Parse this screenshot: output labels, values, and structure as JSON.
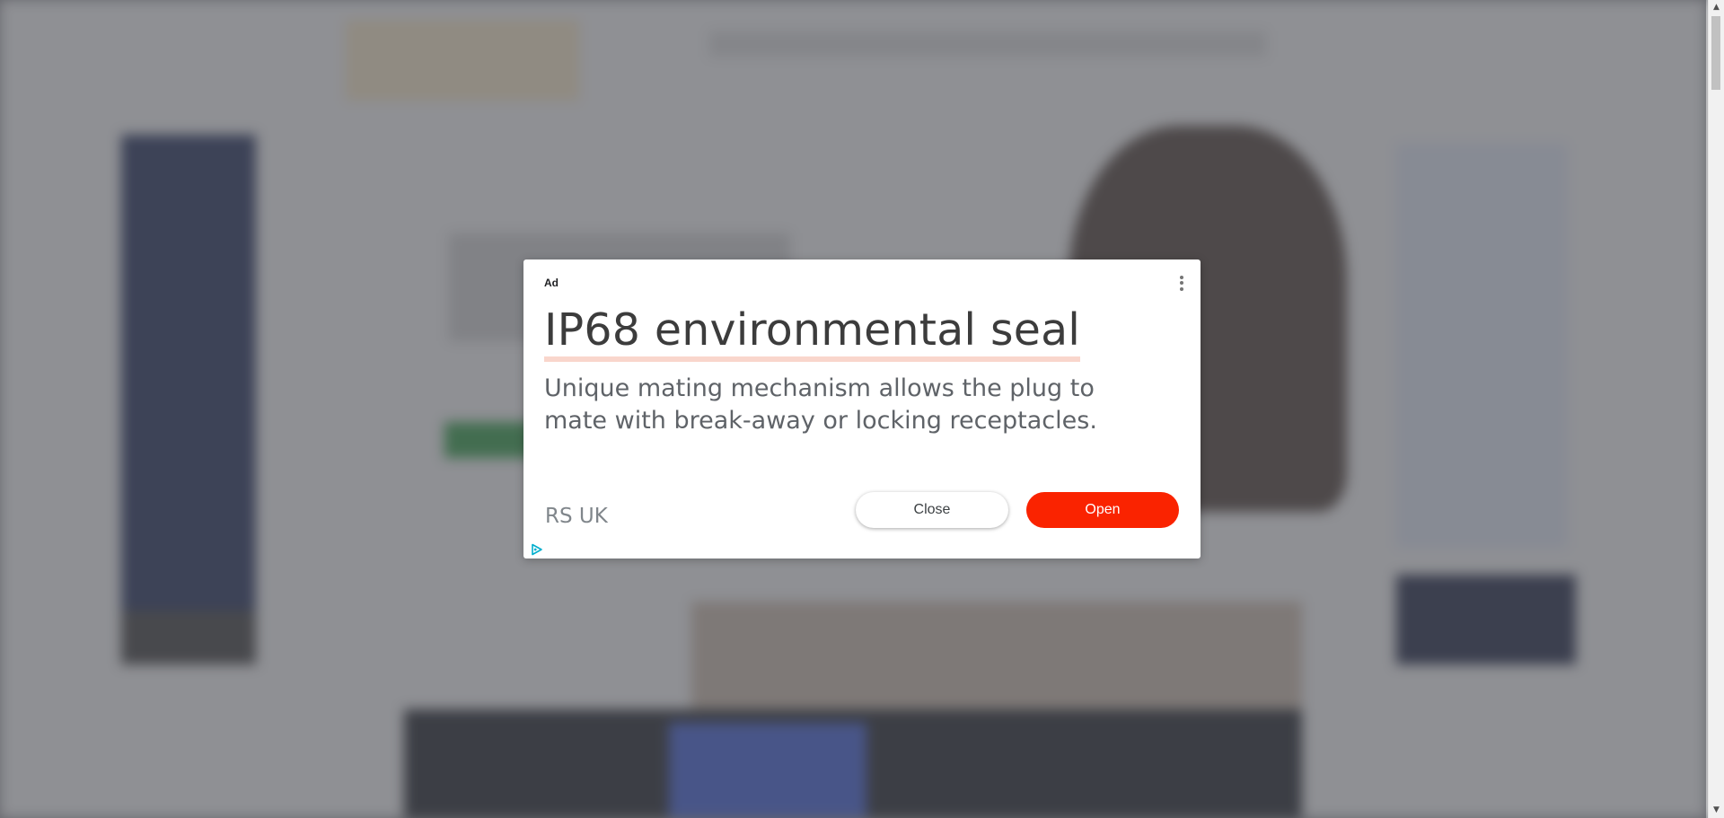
{
  "ad": {
    "label": "Ad",
    "headline": "IP68 environmental seal",
    "description": "Unique mating mechanism allows the plug to mate with break-away or locking receptacles.",
    "advertiser": "RS UK",
    "close_label": "Close",
    "open_label": "Open",
    "menu_icon": "more-vert-icon",
    "adchoices_icon": "adchoices-icon",
    "accent_color": "#fa2300"
  },
  "scrollbar": {
    "up_arrow": "▲",
    "down_arrow": "▼"
  }
}
